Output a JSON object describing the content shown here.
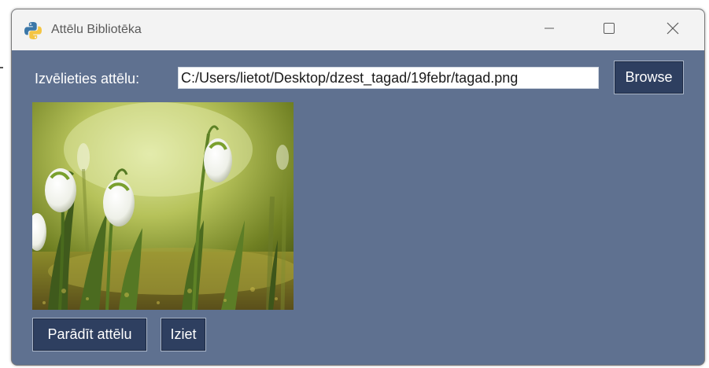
{
  "window": {
    "title": "Attēlu Bibliotēka"
  },
  "form": {
    "select_label": "Izvēlieties attēlu:",
    "path_value": "C:/Users/lietot/Desktop/dzest_tagad/19febr/tagad.png"
  },
  "buttons": {
    "browse": "Browse",
    "show_image": "Parādīt attēlu",
    "exit": "Iziet"
  },
  "image": {
    "subject": "snowdrop flowers"
  },
  "icons": {
    "app": "python-icon",
    "minimize": "minimize-icon",
    "maximize": "maximize-icon",
    "close": "close-icon"
  },
  "colors": {
    "window_background": "#5f7190",
    "button_background": "#2e3f60",
    "titlebar": "#f3f3f3"
  }
}
